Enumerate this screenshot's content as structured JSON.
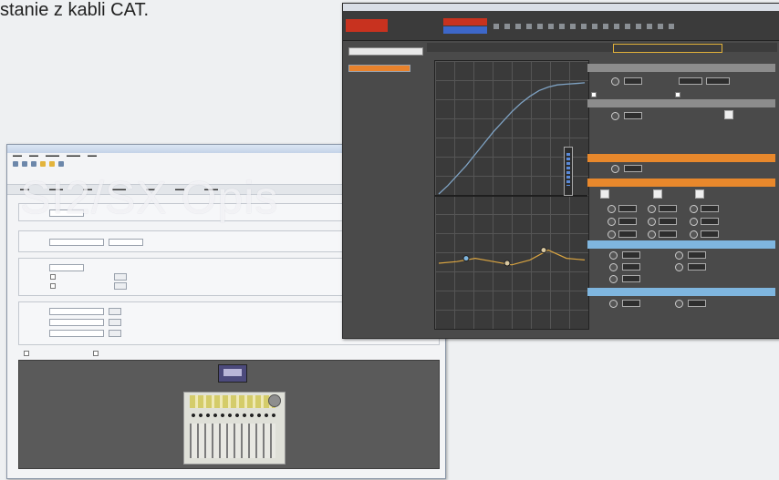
{
  "header_text": "stanie z kabli CAT.",
  "watermark": "SI2/SX Opis",
  "chart_data": {
    "type": "line",
    "x": [
      0,
      1,
      2,
      3,
      4,
      5,
      6,
      7,
      8,
      9,
      10,
      11,
      12,
      13,
      14,
      15,
      16
    ],
    "y": [
      0,
      0.6,
      1.3,
      2.0,
      2.8,
      3.6,
      4.4,
      5.1,
      5.8,
      6.4,
      6.9,
      7.3,
      7.55,
      7.7,
      7.75,
      7.8,
      7.85
    ],
    "ylim": [
      0,
      9
    ],
    "grid": true,
    "xlabel": "",
    "ylabel": ""
  },
  "eq_curve": {
    "type": "line",
    "x": [
      0,
      2,
      4,
      6,
      8,
      10,
      12,
      14,
      16
    ],
    "y": [
      0,
      0.1,
      0.3,
      0.1,
      -0.1,
      0.2,
      0.8,
      0.3,
      0.2
    ],
    "points": [
      {
        "x": 3,
        "y": 0.3,
        "color": "#7fb6df"
      },
      {
        "x": 7.5,
        "y": 0.0,
        "color": "#d9c8a0"
      },
      {
        "x": 11.5,
        "y": 0.8,
        "color": "#d9c8a0"
      }
    ],
    "ylim": [
      -4,
      4
    ]
  },
  "colors": {
    "orange_accent": "#e8882c",
    "blue_accent": "#7fb6df",
    "red_brand": "#c8321f",
    "curve": "#7fa3c4",
    "eq_line": "#d9a441"
  }
}
